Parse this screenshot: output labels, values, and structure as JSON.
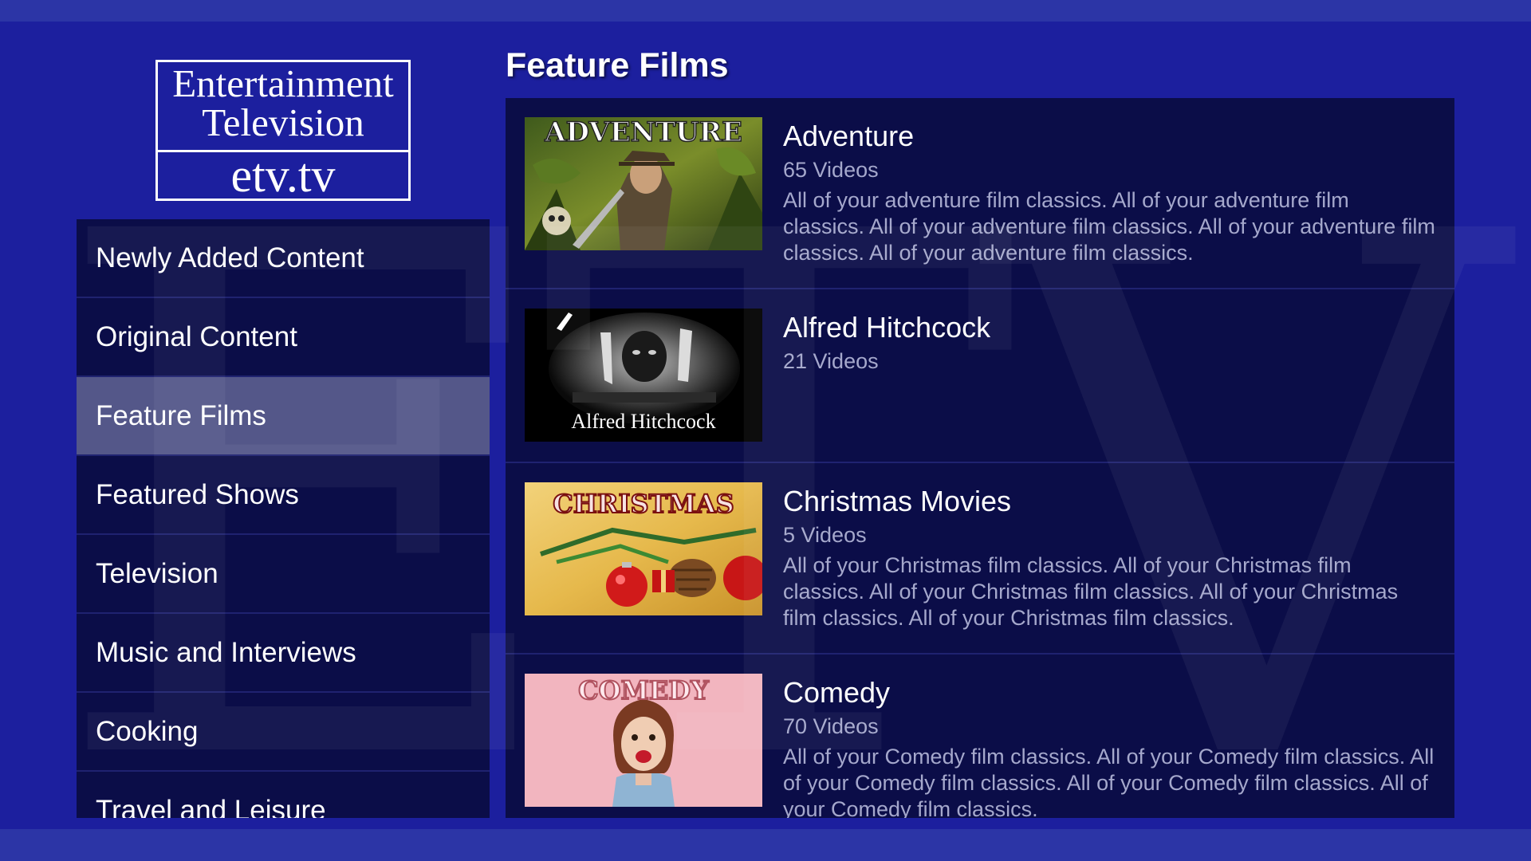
{
  "logo": {
    "line1": "Entertainment",
    "line2": "Television",
    "line3": "etv.tv"
  },
  "watermark": "ETV",
  "page_title": "Feature Films",
  "sidebar": {
    "items": [
      {
        "label": "Newly Added Content",
        "active": false
      },
      {
        "label": "Original Content",
        "active": false
      },
      {
        "label": "Feature Films",
        "active": true
      },
      {
        "label": "Featured Shows",
        "active": false
      },
      {
        "label": "Television",
        "active": false
      },
      {
        "label": "Music and Interviews",
        "active": false
      },
      {
        "label": "Cooking",
        "active": false
      },
      {
        "label": "Travel and Leisure",
        "active": false
      }
    ]
  },
  "categories": [
    {
      "title": "Adventure",
      "count": "65 Videos",
      "thumb_text": "ADVENTURE",
      "description": "All of your adventure film classics.  All of your adventure film classics.  All of your adventure film classics.  All of your adventure film classics.  All of your adventure film classics."
    },
    {
      "title": "Alfred Hitchcock",
      "count": "21 Videos",
      "thumb_text": "Alfred Hitchcock",
      "description": ""
    },
    {
      "title": "Christmas Movies",
      "count": "5 Videos",
      "thumb_text": "CHRISTMAS",
      "description": "All of your Christmas film classics.  All of your Christmas film classics.  All of your Christmas film classics.  All of your Christmas film classics.  All of your Christmas film classics."
    },
    {
      "title": "Comedy",
      "count": "70 Videos",
      "thumb_text": "COMEDY",
      "description": "All of your Comedy film classics.  All of your Comedy film classics.  All of your Comedy film classics.  All of your Comedy film classics.  All of your Comedy film classics."
    }
  ],
  "colors": {
    "background": "#1c1f9e",
    "panel": "#0b0d48",
    "active_item": "#545789",
    "muted_text": "#a5a8cc"
  }
}
